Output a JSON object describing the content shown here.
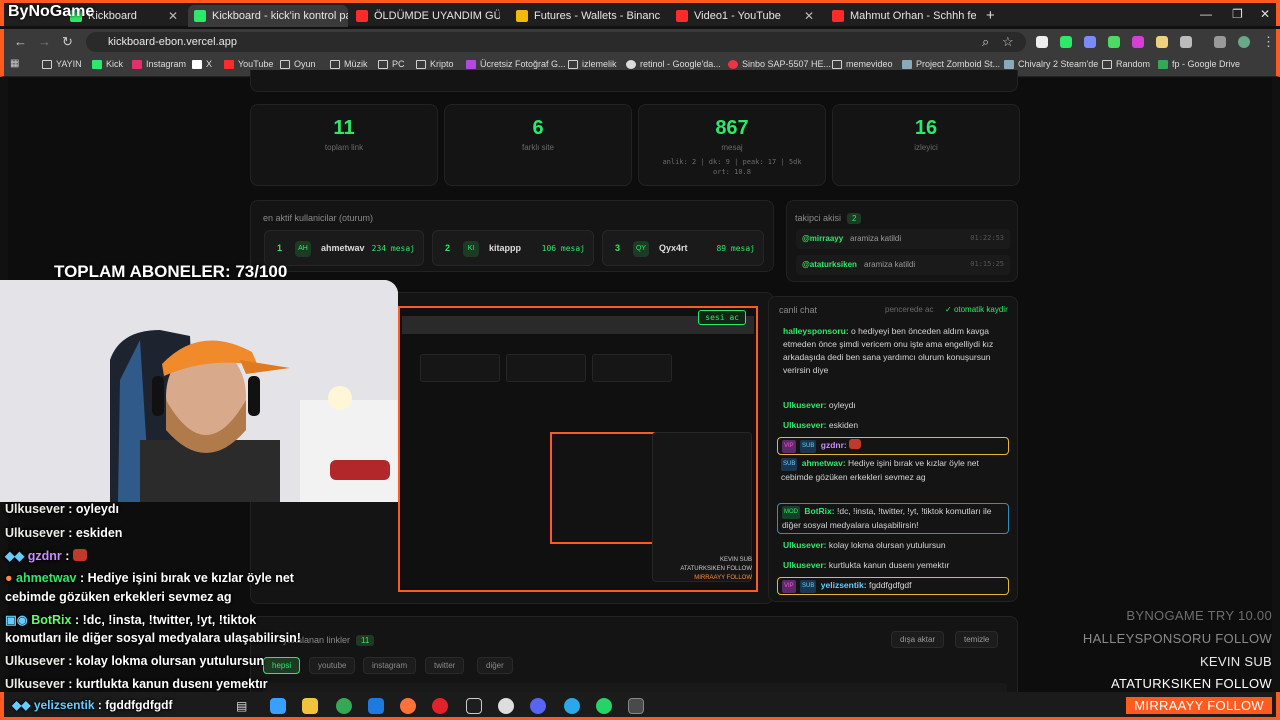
{
  "brand": "ByNoGame",
  "tabs": [
    {
      "title": "Kickboard"
    },
    {
      "title": "Kickboard - kick'in kontrol pan"
    },
    {
      "title": "ÖLDÜMDE UYANDIM GÜLÜM"
    },
    {
      "title": "Futures - Wallets - Binance"
    },
    {
      "title": "Video1 - YouTube"
    },
    {
      "title": "Mahmut Orhan - Schhh fe"
    }
  ],
  "url": "kickboard-ebon.vercel.app",
  "bookmarks": [
    "YAYIN",
    "Kick",
    "Instagram",
    "X",
    "YouTube",
    "Oyun",
    "Müzik",
    "PC",
    "Kripto",
    "Ücretsiz Fotoğraf G...",
    "izlemelik",
    "retinol - Google'da...",
    "Sinbo SAP-5507 HE...",
    "memevideo",
    "Project Zomboid St...",
    "Chivalry 2 Steam'de",
    "Random",
    "fp - Google Drive"
  ],
  "stats": [
    {
      "value": "11",
      "label": "toplam link"
    },
    {
      "value": "6",
      "label": "farklı site"
    },
    {
      "value": "867",
      "label": "mesaj",
      "sub1": "anlik: 2 | dk: 9 | peak: 17 | 5dk",
      "sub2": "ort: 10.8"
    },
    {
      "value": "16",
      "label": "izleyici"
    }
  ],
  "active_users": {
    "title": "en aktif kullanicilar (oturum)",
    "users": [
      {
        "rank": "1",
        "avatar": "AH",
        "name": "ahmetwav",
        "msgs": "234 mesaj"
      },
      {
        "rank": "2",
        "avatar": "KI",
        "name": "kitappp",
        "msgs": "106 mesaj"
      },
      {
        "rank": "3",
        "avatar": "QY",
        "name": "Qyx4rt",
        "msgs": "89 mesaj"
      }
    ]
  },
  "followers": {
    "title": "takipci akisi",
    "count": "2",
    "items": [
      {
        "name": "@mirraayy",
        "text": "aramiza katildi",
        "time": "01:22:53"
      },
      {
        "name": "@ataturksiken",
        "text": "aramiza katildi",
        "time": "01:15:25"
      }
    ]
  },
  "preview": {
    "audio_btn": "sesi ac"
  },
  "live_chat": {
    "title": "canli chat",
    "popout": "pencerede ac",
    "autoscroll": "otomatik kaydir",
    "messages": [
      {
        "user": "halleysponsoru:",
        "text": "o hediyeyi ben önceden aldım kavga etmeden önce şimdi vericem onu işte ama engelliydi kız arkadaşıda dedi ben sana yardımcı olurum konuşursun verirsin diye"
      },
      {
        "user": "Ulkusever:",
        "text": "oyleydı"
      },
      {
        "user": "Ulkusever:",
        "text": "eskiden"
      },
      {
        "vip": "VIP",
        "sub": "SUB",
        "user": "gzdnr:",
        "text": ""
      },
      {
        "sub": "SUB",
        "user": "ahmetwav:",
        "text": "Hediye işini bırak ve kızlar öyle net cebimde gözüken erkekleri sevmez ag"
      },
      {
        "mod": "MOD",
        "user": "BotRix:",
        "text": "!dc, !insta, !twitter, !yt, !tiktok komutları ile diğer sosyal medyalara ulaşabilirsin!"
      },
      {
        "user": "Ulkusever:",
        "text": "kolay lokma olursan yutulursun"
      },
      {
        "user": "Ulkusever:",
        "text": "kurtlukta kanun dusenı yemektır"
      },
      {
        "vip": "VIP",
        "sub": "SUB",
        "user": "yelizsentik:",
        "text": "fgddfgdfgdf"
      }
    ]
  },
  "links": {
    "title": "yakalanan linkler",
    "count": "11",
    "export": "dışa aktar",
    "clear": "temizle",
    "filters": [
      "hepsi",
      "youtube",
      "instagram",
      "twitter",
      "diğer"
    ]
  },
  "overlay": {
    "sub_goal": "TOPLAM ABONELER: 73/100",
    "chat": [
      {
        "user": "Ulkusever",
        "text": ": oyleydı"
      },
      {
        "user": "Ulkusever",
        "text": ": eskiden"
      },
      {
        "user": "gzdnr",
        "text": ":"
      },
      {
        "user": "ahmetwav",
        "text": ": Hediye işini bırak ve kızlar öyle net"
      },
      {
        "user": "",
        "text": "cebimde gözüken erkekleri sevmez ag"
      },
      {
        "user": "BotRix",
        "text": ": !dc, !insta, !twitter, !yt, !tiktok"
      },
      {
        "user": "",
        "text": "komutları ile diğer sosyal medyalara ulaşabilirsin!"
      },
      {
        "user": "Ulkusever",
        "text": ": kolay lokma olursan yutulursun"
      },
      {
        "user": "Ulkusever",
        "text": ": kurtlukta kanun dusenı yemektır"
      },
      {
        "user": "yelizsentik",
        "text": ": fgddfgdfgdf"
      }
    ],
    "side_list": [
      {
        "text": "BYNOGAME  TRY 10.00"
      },
      {
        "text": "HALLEYSPONSORU  FOLLOW"
      },
      {
        "text": "KEVIN  SUB"
      },
      {
        "text": "ATATURKSIKEN  FOLLOW"
      },
      {
        "text": "MIRRAAYY  FOLLOW"
      }
    ]
  },
  "colors": {
    "accent": "#ff5a1f",
    "green": "#2ee86a"
  }
}
